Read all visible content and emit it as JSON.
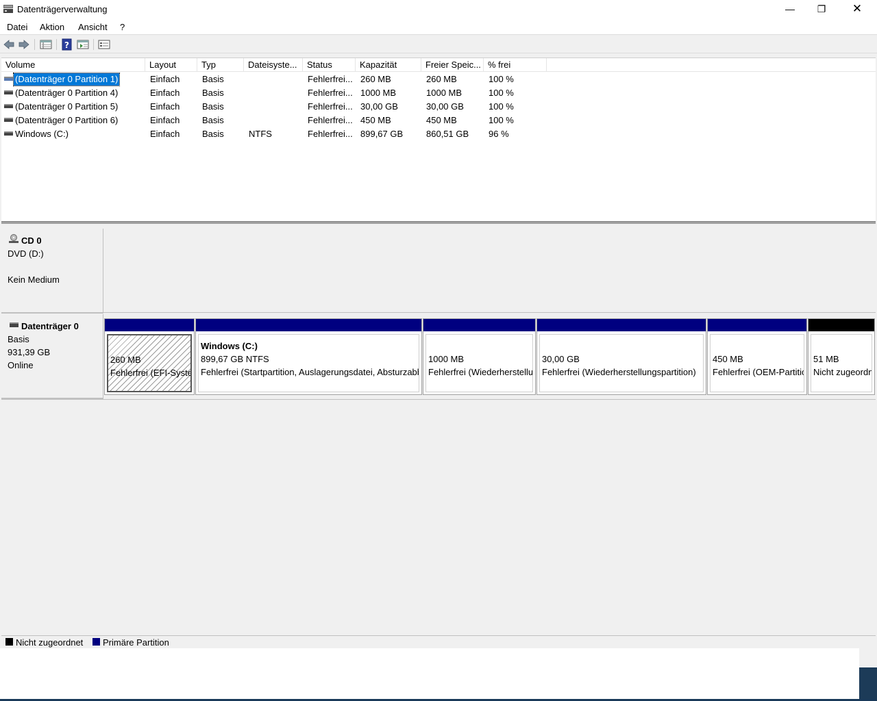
{
  "window": {
    "title": "Datenträgerverwaltung",
    "minimize_glyph": "—",
    "maximize_glyph": "❐",
    "close_glyph": "✕"
  },
  "menu": {
    "items": [
      "Datei",
      "Aktion",
      "Ansicht",
      "?"
    ]
  },
  "toolbar": {
    "icons": [
      "back-arrow-icon",
      "forward-arrow-icon",
      "list-view-icon",
      "help-icon",
      "properties-view-icon",
      "settings-icon"
    ]
  },
  "volume_list": {
    "columns": [
      "Volume",
      "Layout",
      "Typ",
      "Dateisyste...",
      "Status",
      "Kapazität",
      "Freier Speic...",
      "% frei"
    ],
    "rows": [
      {
        "volume": "(Datenträger 0 Partition 1)",
        "layout": "Einfach",
        "typ": "Basis",
        "fs": "",
        "status": "Fehlerfrei...",
        "capacity": "260 MB",
        "free": "260 MB",
        "pct": "100 %",
        "selected": true
      },
      {
        "volume": "(Datenträger 0 Partition 4)",
        "layout": "Einfach",
        "typ": "Basis",
        "fs": "",
        "status": "Fehlerfrei...",
        "capacity": "1000 MB",
        "free": "1000 MB",
        "pct": "100 %",
        "selected": false
      },
      {
        "volume": "(Datenträger 0 Partition 5)",
        "layout": "Einfach",
        "typ": "Basis",
        "fs": "",
        "status": "Fehlerfrei...",
        "capacity": "30,00 GB",
        "free": "30,00 GB",
        "pct": "100 %",
        "selected": false
      },
      {
        "volume": "(Datenträger 0 Partition 6)",
        "layout": "Einfach",
        "typ": "Basis",
        "fs": "",
        "status": "Fehlerfrei...",
        "capacity": "450 MB",
        "free": "450 MB",
        "pct": "100 %",
        "selected": false
      },
      {
        "volume": "Windows (C:)",
        "layout": "Einfach",
        "typ": "Basis",
        "fs": "NTFS",
        "status": "Fehlerfrei...",
        "capacity": "899,67 GB",
        "free": "860,51 GB",
        "pct": "96 %",
        "selected": false
      }
    ]
  },
  "cd0": {
    "name": "CD 0",
    "type": "DVD (D:)",
    "media": "Kein Medium"
  },
  "disk0": {
    "name": "Datenträger 0",
    "type": "Basis",
    "size": "931,39 GB",
    "state": "Online",
    "partitions": [
      {
        "title": "",
        "size": "260 MB",
        "status": "Fehlerfrei (EFI-Systempartition)",
        "kind": "primary",
        "hatched": true
      },
      {
        "title": "Windows  (C:)",
        "size": "899,67 GB NTFS",
        "status": "Fehlerfrei (Startpartition, Auslagerungsdatei, Absturzabbild, Primäre Partition)",
        "kind": "primary",
        "hatched": false
      },
      {
        "title": "",
        "size": "1000 MB",
        "status": "Fehlerfrei (Wiederherstellungspartition)",
        "kind": "primary",
        "hatched": false
      },
      {
        "title": "",
        "size": "30,00 GB",
        "status": "Fehlerfrei (Wiederherstellungspartition)",
        "kind": "primary",
        "hatched": false
      },
      {
        "title": "",
        "size": "450 MB",
        "status": "Fehlerfrei (OEM-Partition)",
        "kind": "primary",
        "hatched": false
      },
      {
        "title": "",
        "size": "51 MB",
        "status": "Nicht zugeordnet",
        "kind": "unallocated",
        "hatched": false
      }
    ]
  },
  "legend": {
    "unallocated": "Nicht zugeordnet",
    "primary": "Primäre Partition",
    "unallocated_color": "#000000",
    "primary_color": "#000080"
  }
}
